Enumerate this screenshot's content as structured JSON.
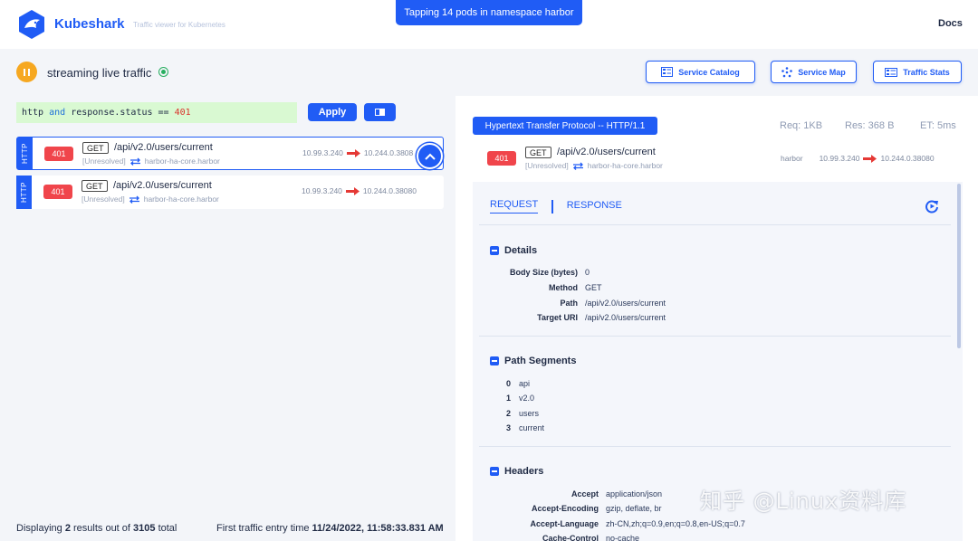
{
  "app": {
    "name": "Kubeshark",
    "tagline": "Traffic viewer for Kubernetes",
    "docs_label": "Docs"
  },
  "banner": {
    "text": "Tapping 14 pods in namespace harbor"
  },
  "status": {
    "text": "streaming live traffic"
  },
  "nav": {
    "service_catalog": "Service Catalog",
    "service_map": "Service Map",
    "traffic_stats": "Traffic Stats"
  },
  "filter": {
    "t1": "http",
    "t2": " ",
    "t3": "and",
    "t4": " response.status == ",
    "t5": "401",
    "apply_label": "Apply"
  },
  "entries": [
    {
      "protocol": "HTTP",
      "status": "401",
      "method": "GET",
      "path": "/api/v2.0/users/current",
      "resolved": "[Unresolved]",
      "service": "harbor-ha-core.harbor",
      "src_ip": "10.99.3.240",
      "dst_ip": "10.244.0.3808"
    },
    {
      "protocol": "HTTP",
      "status": "401",
      "method": "GET",
      "path": "/api/v2.0/users/current",
      "resolved": "[Unresolved]",
      "service": "harbor-ha-core.harbor",
      "src_ip": "10.99.3.240",
      "dst_ip": "10.244.0.38080"
    }
  ],
  "footer": {
    "p1": "Displaying ",
    "count": "2",
    "p2": " results out of ",
    "total": "3105",
    "p3": " total",
    "first_label": "First traffic entry time ",
    "first_time": "11/24/2022, 11:58:33.831 AM"
  },
  "detail": {
    "protocol_badge": "Hypertext Transfer Protocol -- HTTP/1.1",
    "req": "Req: 1KB",
    "res": "Res: 368 B",
    "et": "ET: 5ms",
    "status": "401",
    "method": "GET",
    "path": "/api/v2.0/users/current",
    "resolved": "[Unresolved]",
    "service": "harbor-ha-core.harbor",
    "namespace": "harbor",
    "src_ip": "10.99.3.240",
    "dst_ip": "10.244.0.38080",
    "tabs": {
      "request": "REQUEST",
      "response": "RESPONSE"
    },
    "details_title": "Details",
    "details": [
      {
        "k": "Body Size (bytes)",
        "v": "0"
      },
      {
        "k": "Method",
        "v": "GET"
      },
      {
        "k": "Path",
        "v": "/api/v2.0/users/current"
      },
      {
        "k": "Target URI",
        "v": "/api/v2.0/users/current"
      }
    ],
    "segments_title": "Path Segments",
    "segments": [
      {
        "i": "0",
        "v": "api"
      },
      {
        "i": "1",
        "v": "v2.0"
      },
      {
        "i": "2",
        "v": "users"
      },
      {
        "i": "3",
        "v": "current"
      }
    ],
    "headers_title": "Headers",
    "headers": [
      {
        "k": "Accept",
        "v": "application/json"
      },
      {
        "k": "Accept-Encoding",
        "v": "gzip, deflate, br"
      },
      {
        "k": "Accept-Language",
        "v": "zh-CN,zh;q=0.9,en;q=0.8,en-US;q=0.7"
      },
      {
        "k": "Cache-Control",
        "v": "no-cache"
      }
    ]
  },
  "watermark": "知乎 @Linux资料库",
  "colors": {
    "accent": "#205cf5",
    "error": "#f0454b",
    "live": "#27ae60",
    "pause": "#f6a821",
    "filter_ok": "#d9f9d2"
  }
}
